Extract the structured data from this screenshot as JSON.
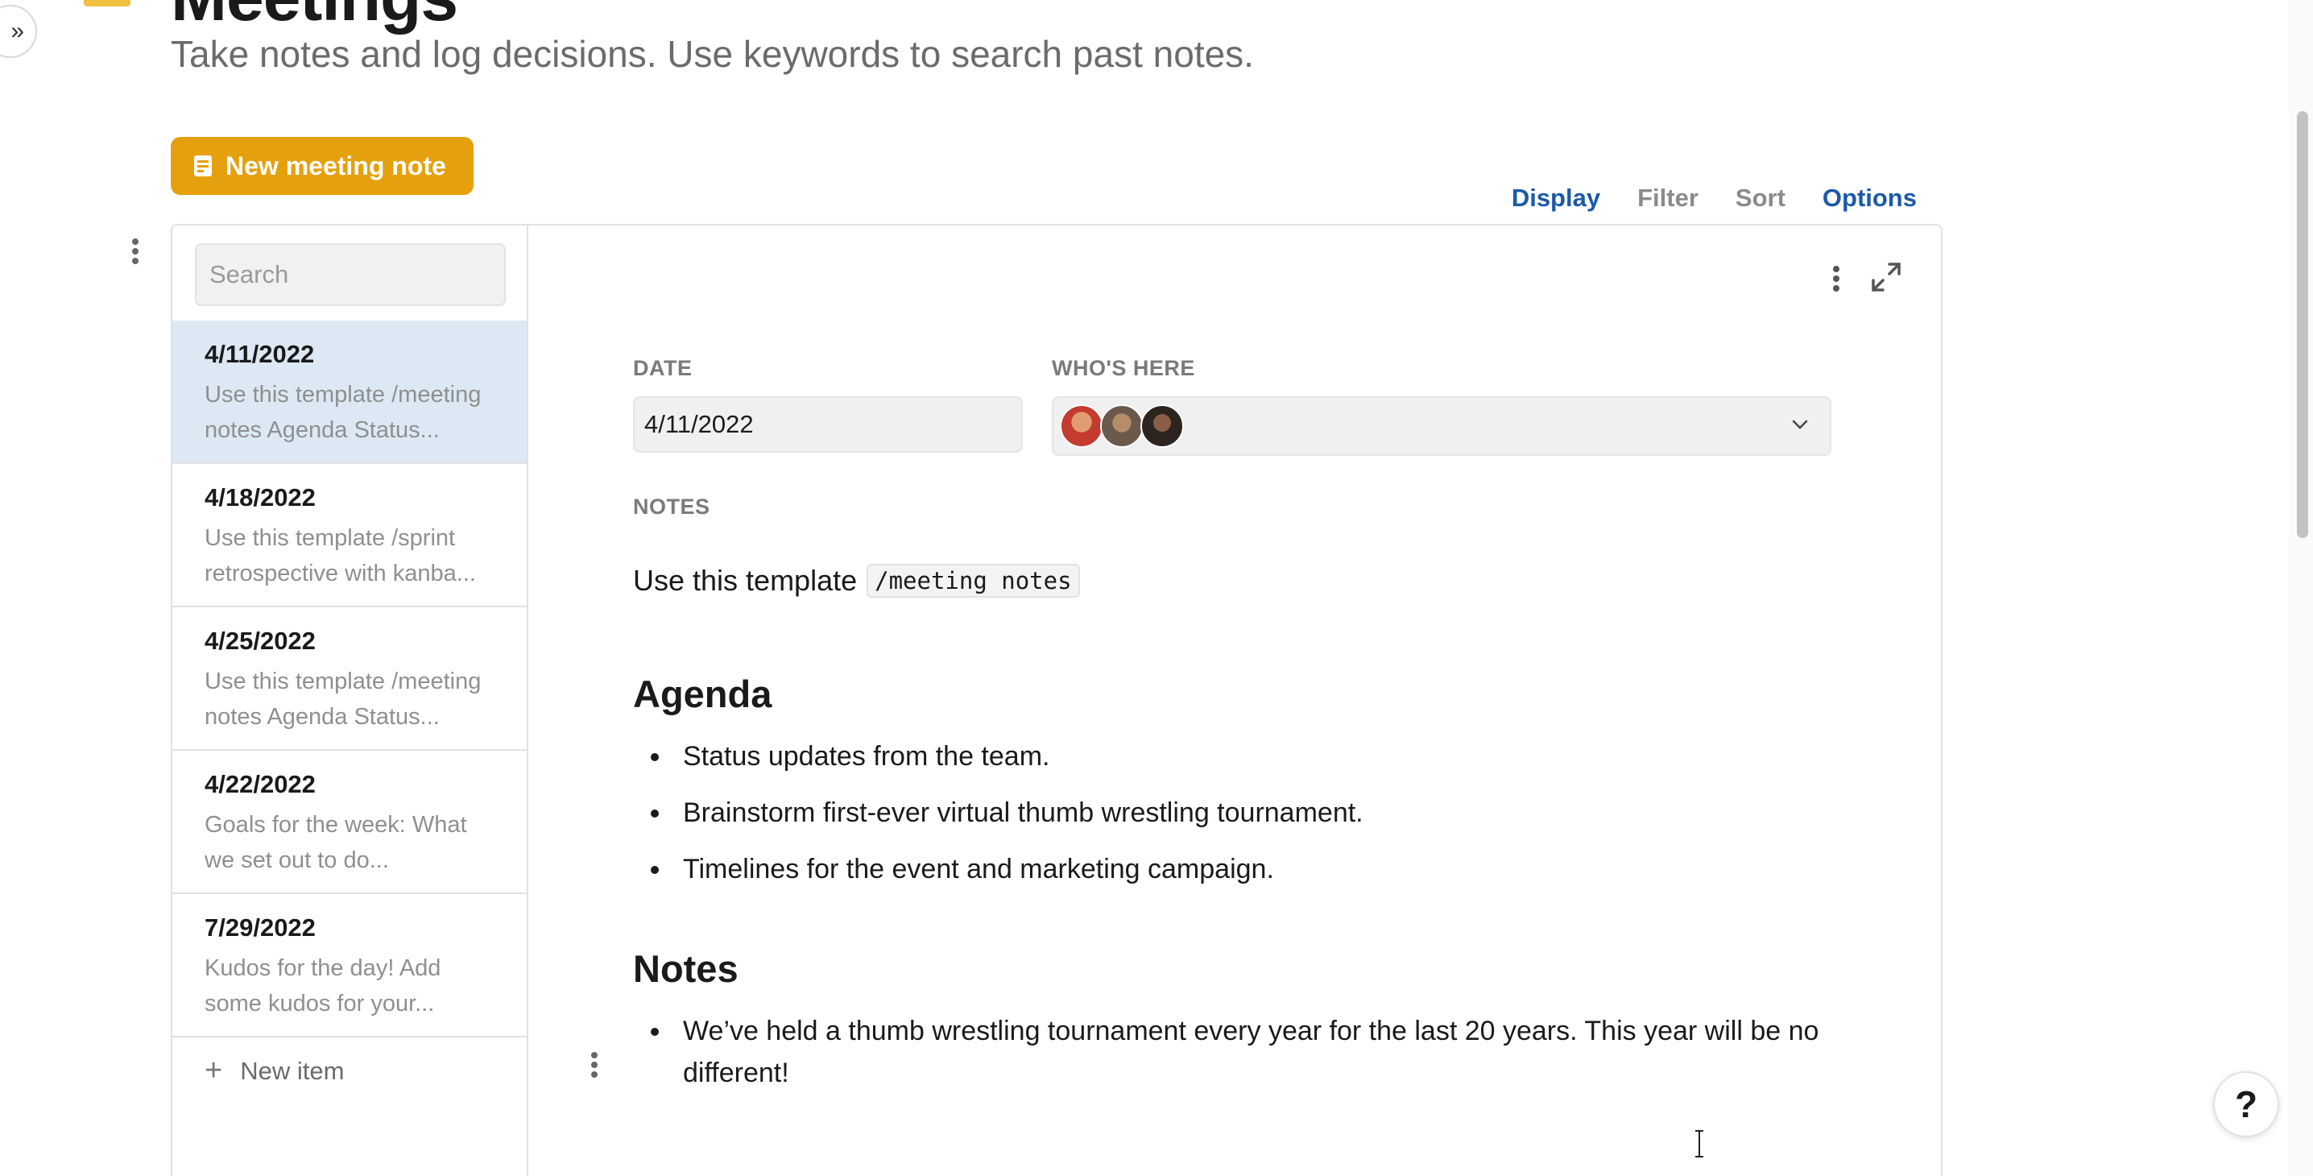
{
  "header": {
    "title": "Meetings",
    "subtitle": "Take notes and log decisions. Use keywords to search past notes.",
    "new_button_label": "New meeting note"
  },
  "toolbar": {
    "display": "Display",
    "filter": "Filter",
    "sort": "Sort",
    "options": "Options"
  },
  "list": {
    "search_placeholder": "Search",
    "items": [
      {
        "date": "4/11/2022",
        "preview": "Use this template /meeting notes Agenda Status...",
        "selected": true
      },
      {
        "date": "4/18/2022",
        "preview": "Use this template /sprint retrospective with kanba...",
        "selected": false
      },
      {
        "date": "4/25/2022",
        "preview": "Use this template /meeting notes Agenda Status...",
        "selected": false
      },
      {
        "date": "4/22/2022",
        "preview": "Goals for the week: What we set out to do...",
        "selected": false
      },
      {
        "date": "7/29/2022",
        "preview": "Kudos for the day! Add some kudos for your...",
        "selected": false
      }
    ],
    "new_item_label": "New item"
  },
  "detail": {
    "date_label": "DATE",
    "date_value": "4/11/2022",
    "who_label": "WHO'S HERE",
    "notes_label": "NOTES",
    "intro_text": "Use this template",
    "intro_code": "/meeting notes",
    "agenda_heading": "Agenda",
    "agenda_items": [
      "Status updates from the team.",
      "Brainstorm first-ever virtual thumb wrestling tournament.",
      "Timelines for the event and marketing campaign."
    ],
    "notes_heading": "Notes",
    "notes_items": [
      "We’ve held a thumb wrestling tournament every year for the last 20 years. This year will be no different!"
    ]
  },
  "help": {
    "label": "?"
  },
  "colors": {
    "accent_button": "#e5a00d",
    "link_blue": "#1b5aa6",
    "selected_row": "#dce9f5"
  }
}
